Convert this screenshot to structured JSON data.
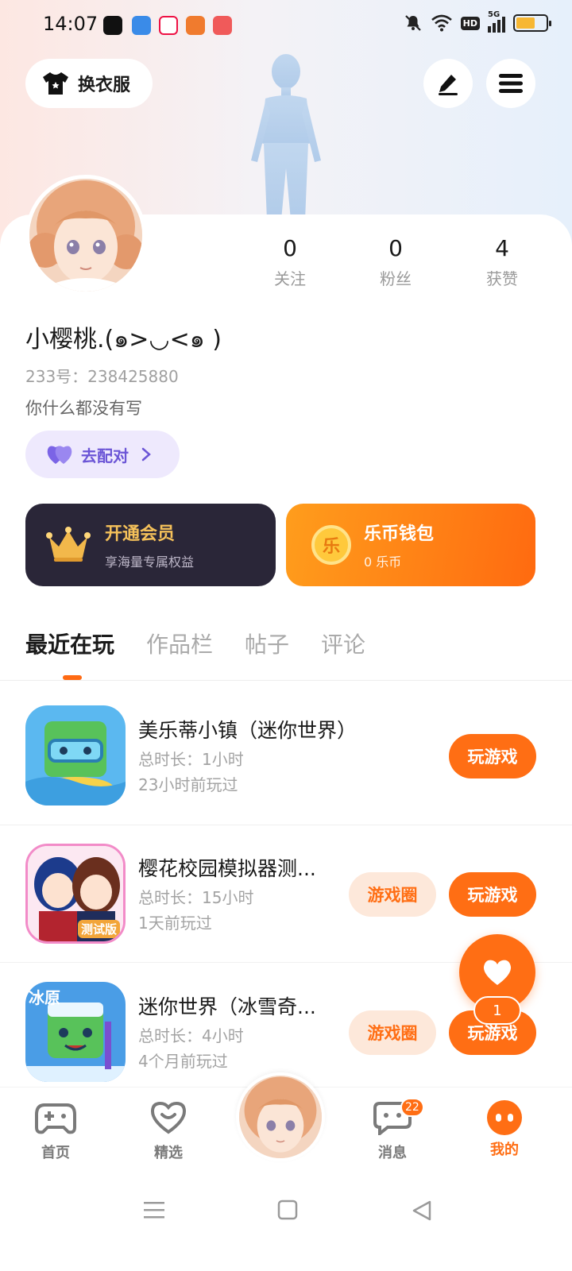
{
  "status_bar": {
    "time": "14:07",
    "network": "5G",
    "hd": "HD",
    "battery_level": 0.65
  },
  "header": {
    "outfit_label": "换衣服",
    "edit_icon": "pen-icon",
    "menu_icon": "menu-icon"
  },
  "profile": {
    "stats": [
      {
        "value": "0",
        "label": "关注"
      },
      {
        "value": "0",
        "label": "粉丝"
      },
      {
        "value": "4",
        "label": "获赞"
      }
    ],
    "username": "小樱桃.(๑>◡<๑ )",
    "uid": "233号：238425880",
    "bio": "你什么都没有写",
    "match_label": "去配对"
  },
  "cards": {
    "vip": {
      "title": "开通会员",
      "subtitle": "享海量专属权益"
    },
    "wallet": {
      "title": "乐币钱包",
      "subtitle": "0 乐币",
      "coin_glyph": "乐"
    }
  },
  "tabs": [
    "最近在玩",
    "作品栏",
    "帖子",
    "评论"
  ],
  "games": [
    {
      "name": "美乐蒂小镇（迷你世界）",
      "duration": "总时长：1小时",
      "last_played": "23小时前玩过",
      "play_label": "玩游戏",
      "circle_label": ""
    },
    {
      "name": "樱花校园模拟器测...",
      "duration": "总时长：15小时",
      "last_played": "1天前玩过",
      "play_label": "玩游戏",
      "circle_label": "游戏圈",
      "icon_text": "测试版"
    },
    {
      "name": "迷你世界（冰雪奇...",
      "duration": "总时长：4小时",
      "last_played": "4个月前玩过",
      "play_label": "玩游戏",
      "circle_label": "游戏圈",
      "icon_text": "冰原"
    }
  ],
  "fab": {
    "count": "1"
  },
  "bottom_nav": {
    "items": [
      {
        "label": "首页"
      },
      {
        "label": "精选"
      },
      {
        "label": "消息",
        "badge": "22"
      },
      {
        "label": "我的"
      }
    ]
  },
  "colors": {
    "accent": "#ff6e14",
    "vip_bg": "#2a2638",
    "match_text": "#6b55d6"
  }
}
